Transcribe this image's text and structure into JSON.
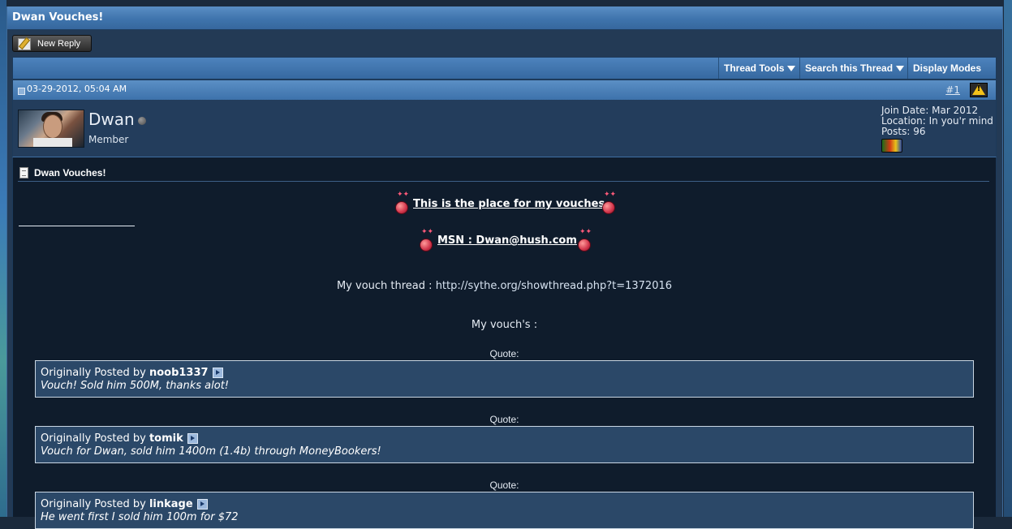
{
  "thread": {
    "title": "Dwan Vouches!"
  },
  "toolbar": {
    "new_reply_label": "New Reply",
    "thread_tools": "Thread Tools",
    "search_thread": "Search this Thread",
    "display_modes": "Display Modes"
  },
  "post": {
    "date": "03-29-2012, 05:04 AM",
    "number": "#1",
    "title": "Dwan Vouches!",
    "user": {
      "name": "Dwan",
      "title": "Member",
      "join_date": "Join Date: Mar 2012",
      "location": "Location: In you'r mind",
      "posts": "Posts: 96"
    },
    "body": {
      "heading": "This is the place for my vouches",
      "msn": "MSN : Dwan@hush.com",
      "vouch_thread_label": "My vouch thread : ",
      "vouch_thread_url": "http://sythe.org/showthread.php?t=1372016",
      "vouchs_label": "My vouch's :",
      "quotes": [
        {
          "label": "Quote:",
          "prefix": "Originally Posted by ",
          "author": "noob1337",
          "text": "Vouch! Sold him 500M, thanks alot!"
        },
        {
          "label": "Quote:",
          "prefix": "Originally Posted by ",
          "author": "tomik",
          "text": "Vouch for Dwan, sold him 1400m (1.4b) through MoneyBookers!"
        },
        {
          "label": "Quote:",
          "prefix": "Originally Posted by ",
          "author": "linkage",
          "text": "He went first I sold him 100m for $72"
        }
      ]
    }
  },
  "colors": {
    "accent": "#3f74ad",
    "content_bg": "#0f1c2c",
    "quote_bg": "#2b4868"
  }
}
